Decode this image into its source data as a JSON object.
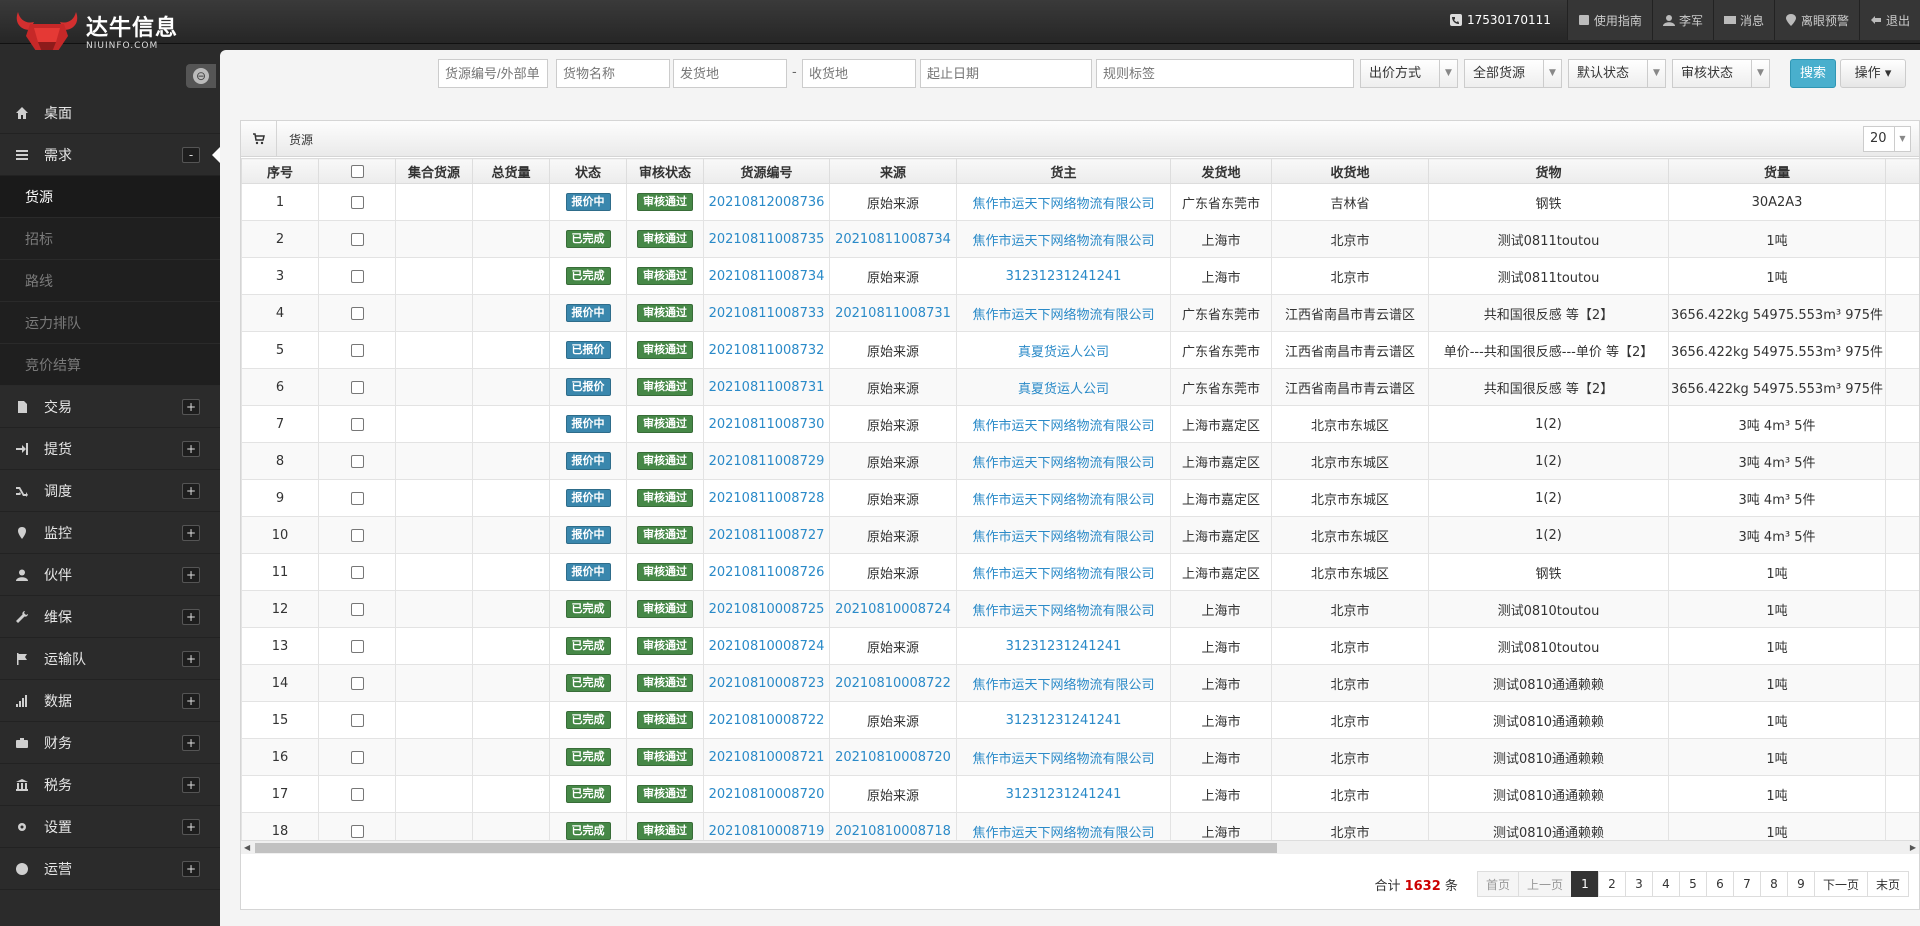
{
  "header": {
    "logo_cn": "达牛信息",
    "logo_en": "NIUINFO.COM",
    "phone": "17530170111",
    "links": [
      {
        "icon": "book-icon",
        "label": "使用指南"
      },
      {
        "icon": "user-icon",
        "label": "李军"
      },
      {
        "icon": "mail-icon",
        "label": "消息"
      },
      {
        "icon": "pin-icon",
        "label": "离眼预警"
      },
      {
        "icon": "logout-icon",
        "label": "退出"
      }
    ]
  },
  "sidebar": {
    "toggle_icon": "⊖",
    "items": [
      {
        "id": "desktop",
        "icon": "home-icon",
        "label": "桌面",
        "toggle": ""
      },
      {
        "id": "demand",
        "icon": "list-icon",
        "label": "需求",
        "toggle": "-",
        "open": true,
        "children": [
          {
            "label": "货源",
            "active": true
          },
          {
            "label": "招标"
          },
          {
            "label": "路线"
          },
          {
            "label": "运力排队"
          },
          {
            "label": "竞价结算"
          }
        ]
      },
      {
        "id": "trade",
        "icon": "doc-icon",
        "label": "交易",
        "toggle": "+"
      },
      {
        "id": "pickup",
        "icon": "signin-icon",
        "label": "提货",
        "toggle": "+"
      },
      {
        "id": "dispatch",
        "icon": "shuffle-icon",
        "label": "调度",
        "toggle": "+"
      },
      {
        "id": "monitor",
        "icon": "location-icon",
        "label": "监控",
        "toggle": "+"
      },
      {
        "id": "partner",
        "icon": "user-icon",
        "label": "伙伴",
        "toggle": "+"
      },
      {
        "id": "maintain",
        "icon": "wrench-icon",
        "label": "维保",
        "toggle": "+"
      },
      {
        "id": "fleet",
        "icon": "flag-icon",
        "label": "运输队",
        "toggle": "+"
      },
      {
        "id": "data",
        "icon": "signal-icon",
        "label": "数据",
        "toggle": "+"
      },
      {
        "id": "finance",
        "icon": "briefcase-icon",
        "label": "财务",
        "toggle": "+"
      },
      {
        "id": "tax",
        "icon": "bank-icon",
        "label": "税务",
        "toggle": "+"
      },
      {
        "id": "settings",
        "icon": "gear-icon",
        "label": "设置",
        "toggle": "+"
      },
      {
        "id": "operation",
        "icon": "globe-icon",
        "label": "运营",
        "toggle": "+"
      }
    ]
  },
  "filters": {
    "source_no_placeholder": "货源编号/外部单",
    "goods_name_placeholder": "货物名称",
    "origin_placeholder": "发货地",
    "dash": "-",
    "dest_placeholder": "收货地",
    "date_placeholder": "起止日期",
    "rule_placeholder": "规则标签",
    "bid_mode": "出价方式",
    "all_sources": "全部货源",
    "default_status": "默认状态",
    "audit_status": "审核状态",
    "search_label": "搜索",
    "op_label": "操作",
    "op_caret": "▾"
  },
  "panel": {
    "title": "货源",
    "page_size": "20"
  },
  "table": {
    "columns": [
      "序号",
      "",
      "集合货源",
      "总货量",
      "状态",
      "审核状态",
      "货源编号",
      "来源",
      "货主",
      "发货地",
      "收货地",
      "货物",
      "货量",
      ""
    ],
    "badge_colors": {
      "报价中": "#3a87ad",
      "已完成": "#468847",
      "已报价": "#3a87ad",
      "审核通过": "#468847"
    },
    "rows": [
      {
        "no": "1",
        "status": "报价中",
        "audit": "审核通过",
        "code": "20210812008736",
        "source": "原始来源",
        "source_link": false,
        "owner": "焦作市运天下网络物流有限公司",
        "from": "广东省东莞市",
        "to": "吉林省",
        "goods": "钢铁",
        "qty": "30A2A3"
      },
      {
        "no": "2",
        "status": "已完成",
        "audit": "审核通过",
        "code": "20210811008735",
        "source": "20210811008734",
        "source_link": true,
        "owner": "焦作市运天下网络物流有限公司",
        "from": "上海市",
        "to": "北京市",
        "goods": "测试0811toutou",
        "qty": "1吨"
      },
      {
        "no": "3",
        "status": "已完成",
        "audit": "审核通过",
        "code": "20210811008734",
        "source": "原始来源",
        "source_link": false,
        "owner": "31231231241241",
        "from": "上海市",
        "to": "北京市",
        "goods": "测试0811toutou",
        "qty": "1吨"
      },
      {
        "no": "4",
        "status": "报价中",
        "audit": "审核通过",
        "code": "20210811008733",
        "source": "20210811008731",
        "source_link": true,
        "owner": "焦作市运天下网络物流有限公司",
        "from": "广东省东莞市",
        "to": "江西省南昌市青云谱区",
        "goods": "共和国很反感 等【2】",
        "qty": "3656.422kg 54975.553m³ 975件"
      },
      {
        "no": "5",
        "status": "已报价",
        "audit": "审核通过",
        "code": "20210811008732",
        "source": "原始来源",
        "source_link": false,
        "owner": "真夏货运人公司",
        "from": "广东省东莞市",
        "to": "江西省南昌市青云谱区",
        "goods": "单价---共和国很反感---单价 等【2】",
        "qty": "3656.422kg 54975.553m³ 975件"
      },
      {
        "no": "6",
        "status": "已报价",
        "audit": "审核通过",
        "code": "20210811008731",
        "source": "原始来源",
        "source_link": false,
        "owner": "真夏货运人公司",
        "from": "广东省东莞市",
        "to": "江西省南昌市青云谱区",
        "goods": "共和国很反感 等【2】",
        "qty": "3656.422kg 54975.553m³ 975件"
      },
      {
        "no": "7",
        "status": "报价中",
        "audit": "审核通过",
        "code": "20210811008730",
        "source": "原始来源",
        "source_link": false,
        "owner": "焦作市运天下网络物流有限公司",
        "from": "上海市嘉定区",
        "to": "北京市东城区",
        "goods": "1(2)",
        "qty": "3吨 4m³ 5件"
      },
      {
        "no": "8",
        "status": "报价中",
        "audit": "审核通过",
        "code": "20210811008729",
        "source": "原始来源",
        "source_link": false,
        "owner": "焦作市运天下网络物流有限公司",
        "from": "上海市嘉定区",
        "to": "北京市东城区",
        "goods": "1(2)",
        "qty": "3吨 4m³ 5件"
      },
      {
        "no": "9",
        "status": "报价中",
        "audit": "审核通过",
        "code": "20210811008728",
        "source": "原始来源",
        "source_link": false,
        "owner": "焦作市运天下网络物流有限公司",
        "from": "上海市嘉定区",
        "to": "北京市东城区",
        "goods": "1(2)",
        "qty": "3吨 4m³ 5件"
      },
      {
        "no": "10",
        "status": "报价中",
        "audit": "审核通过",
        "code": "20210811008727",
        "source": "原始来源",
        "source_link": false,
        "owner": "焦作市运天下网络物流有限公司",
        "from": "上海市嘉定区",
        "to": "北京市东城区",
        "goods": "1(2)",
        "qty": "3吨 4m³ 5件"
      },
      {
        "no": "11",
        "status": "报价中",
        "audit": "审核通过",
        "code": "20210811008726",
        "source": "原始来源",
        "source_link": false,
        "owner": "焦作市运天下网络物流有限公司",
        "from": "上海市嘉定区",
        "to": "北京市东城区",
        "goods": "钢铁",
        "qty": "1吨"
      },
      {
        "no": "12",
        "status": "已完成",
        "audit": "审核通过",
        "code": "20210810008725",
        "source": "20210810008724",
        "source_link": true,
        "owner": "焦作市运天下网络物流有限公司",
        "from": "上海市",
        "to": "北京市",
        "goods": "测试0810toutou",
        "qty": "1吨"
      },
      {
        "no": "13",
        "status": "已完成",
        "audit": "审核通过",
        "code": "20210810008724",
        "source": "原始来源",
        "source_link": false,
        "owner": "31231231241241",
        "from": "上海市",
        "to": "北京市",
        "goods": "测试0810toutou",
        "qty": "1吨"
      },
      {
        "no": "14",
        "status": "已完成",
        "audit": "审核通过",
        "code": "20210810008723",
        "source": "20210810008722",
        "source_link": true,
        "owner": "焦作市运天下网络物流有限公司",
        "from": "上海市",
        "to": "北京市",
        "goods": "测试0810通通赖赖",
        "qty": "1吨"
      },
      {
        "no": "15",
        "status": "已完成",
        "audit": "审核通过",
        "code": "20210810008722",
        "source": "原始来源",
        "source_link": false,
        "owner": "31231231241241",
        "from": "上海市",
        "to": "北京市",
        "goods": "测试0810通通赖赖",
        "qty": "1吨"
      },
      {
        "no": "16",
        "status": "已完成",
        "audit": "审核通过",
        "code": "20210810008721",
        "source": "20210810008720",
        "source_link": true,
        "owner": "焦作市运天下网络物流有限公司",
        "from": "上海市",
        "to": "北京市",
        "goods": "测试0810通通赖赖",
        "qty": "1吨"
      },
      {
        "no": "17",
        "status": "已完成",
        "audit": "审核通过",
        "code": "20210810008720",
        "source": "原始来源",
        "source_link": false,
        "owner": "31231231241241",
        "from": "上海市",
        "to": "北京市",
        "goods": "测试0810通通赖赖",
        "qty": "1吨"
      },
      {
        "no": "18",
        "status": "已完成",
        "audit": "审核通过",
        "code": "20210810008719",
        "source": "20210810008718",
        "source_link": true,
        "owner": "焦作市运天下网络物流有限公司",
        "from": "上海市",
        "to": "北京市",
        "goods": "测试0810通通赖赖",
        "qty": "1吨"
      }
    ]
  },
  "pagination": {
    "total_prefix": "合计",
    "total": "1632",
    "total_suffix": "条",
    "first": "首页",
    "prev": "上一页",
    "pages": [
      "1",
      "2",
      "3",
      "4",
      "5",
      "6",
      "7",
      "8",
      "9"
    ],
    "current": "1",
    "next": "下一页",
    "last": "末页"
  }
}
